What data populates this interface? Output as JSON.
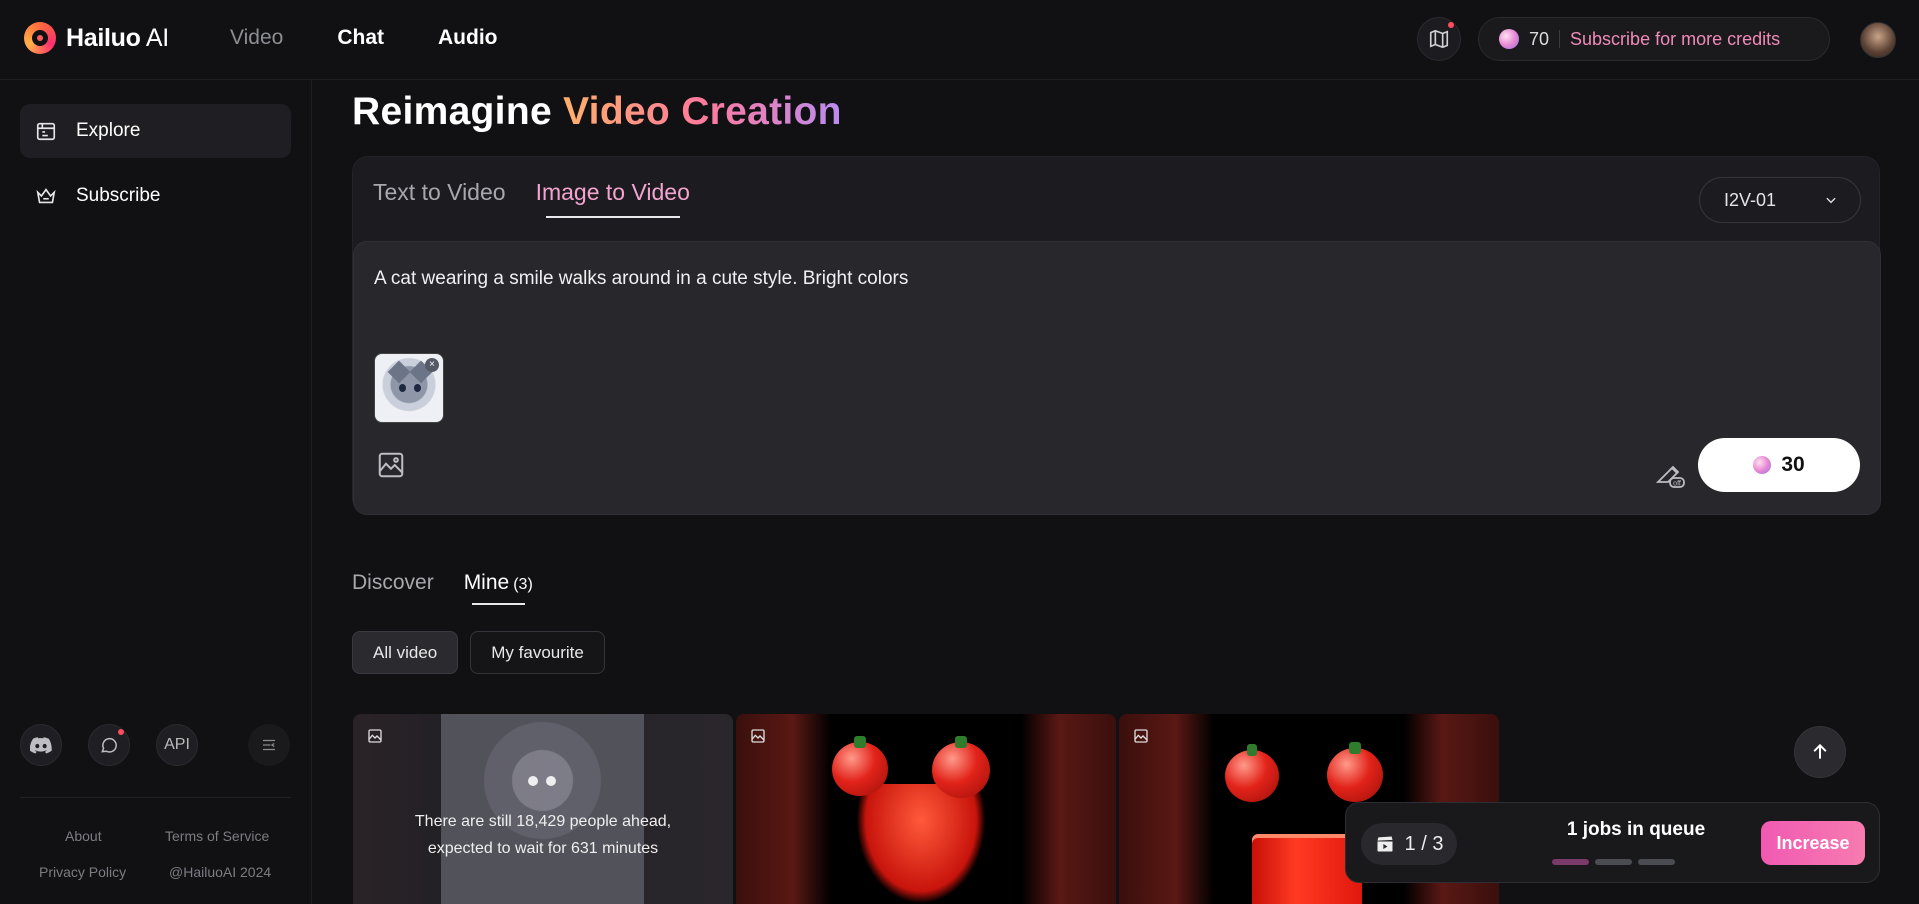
{
  "brand": {
    "name": "Hailuo",
    "suffix": " AI"
  },
  "topnav": {
    "video": "Video",
    "chat": "Chat",
    "audio": "Audio"
  },
  "credits": {
    "amount": "70",
    "subscribe": "Subscribe for more credits"
  },
  "sidebar": {
    "items": [
      {
        "label": "Explore",
        "icon": "explore-icon",
        "active": true
      },
      {
        "label": "Subscribe",
        "icon": "crown-icon",
        "active": false
      }
    ],
    "api_label": "API",
    "footer": {
      "about": "About",
      "terms": "Terms of Service",
      "privacy": "Privacy Policy",
      "copyright": "@HailuoAI 2024"
    }
  },
  "hero": {
    "title_plain": "Reimagine ",
    "title_accent": "Video Creation"
  },
  "creator": {
    "tabs": [
      "Text to Video",
      "Image to Video"
    ],
    "active_tab": "Image to Video",
    "model": "I2V-01",
    "prompt": "A cat wearing a smile walks around in a cute style. Bright colors",
    "generate_cost": "30"
  },
  "feed": {
    "tabs": {
      "discover": "Discover",
      "mine": "Mine",
      "mine_count": "(3)"
    },
    "filters": {
      "all": "All video",
      "favourite": "My favourite"
    },
    "queue_message_line1": "There are still 18,429 people ahead,",
    "queue_message_line2": "expected to wait for 631 minutes"
  },
  "queue": {
    "count": "1 / 3",
    "label": "1 jobs in queue",
    "increase": "Increase",
    "progress_segments": 3,
    "progress_done": 1
  },
  "colors": {
    "accent_pink": "#f08ab8",
    "increase": "#f05ab2",
    "background": "#111113"
  }
}
